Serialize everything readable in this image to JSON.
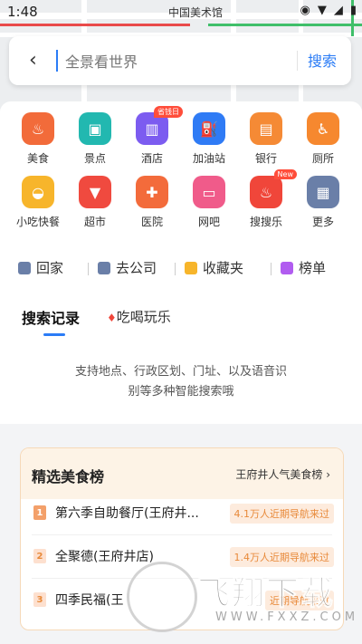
{
  "status_bar": {
    "time": "1:48",
    "map_label": "中国美术馆",
    "icons": [
      "location-icon",
      "wifi-icon",
      "signal-icon",
      "battery-icon"
    ]
  },
  "search": {
    "back_icon": "chevron-left-icon",
    "placeholder": "全景看世界",
    "button_label": "搜索"
  },
  "categories": [
    {
      "label": "美食",
      "icon": "food-icon",
      "color": "#f26b3a"
    },
    {
      "label": "景点",
      "icon": "scenery-icon",
      "color": "#22b8b0"
    },
    {
      "label": "酒店",
      "icon": "hotel-icon",
      "color": "#7c5cf0",
      "badge": "省钱日"
    },
    {
      "label": "加油站",
      "icon": "gas-station-icon",
      "color": "#2f7bf5"
    },
    {
      "label": "银行",
      "icon": "bank-icon",
      "color": "#f58a35"
    },
    {
      "label": "厕所",
      "icon": "toilet-icon",
      "color": "#f6882f"
    },
    {
      "label": "小吃快餐",
      "icon": "snack-icon",
      "color": "#f7b52b"
    },
    {
      "label": "超市",
      "icon": "supermarket-icon",
      "color": "#f04a3f"
    },
    {
      "label": "医院",
      "icon": "hospital-icon",
      "color": "#f36b3b"
    },
    {
      "label": "网吧",
      "icon": "internet-cafe-icon",
      "color": "#f05b8a"
    },
    {
      "label": "搜搜乐",
      "icon": "fire-icon",
      "color": "#f0463a",
      "badge": "New"
    },
    {
      "label": "更多",
      "icon": "more-icon",
      "color": "#6a7fa8"
    }
  ],
  "shortcuts": [
    {
      "label": "回家",
      "icon": "home-icon",
      "color": "#6a7fa8"
    },
    {
      "label": "去公司",
      "icon": "briefcase-icon",
      "color": "#6a7fa8"
    },
    {
      "label": "收藏夹",
      "icon": "star-folder-icon",
      "color": "#f7b52b"
    },
    {
      "label": "榜单",
      "icon": "ranking-icon",
      "color": "#b15cf0"
    }
  ],
  "tabs": [
    {
      "label": "搜索记录",
      "active": true
    },
    {
      "label": "吃喝玩乐",
      "active": false
    }
  ],
  "hint": {
    "line1": "支持地点、行政区划、门址、以及语音识",
    "line2": "别等多种智能搜索哦"
  },
  "food_rank": {
    "title": "精选美食榜",
    "link": "王府井人气美食榜",
    "items": [
      {
        "rank": "1",
        "name": "第六季自助餐厅(王府井...",
        "tag": "4.1万人近期导航来过"
      },
      {
        "rank": "2",
        "name": "全聚德(王府井店)",
        "tag": "1.4万人近期导航来过"
      },
      {
        "rank": "3",
        "name": "四季民福(王",
        "tag": "近期导航来过"
      }
    ]
  },
  "watermark": {
    "text": "飞翔下载",
    "url": "WWW.FXXZ.COM"
  }
}
